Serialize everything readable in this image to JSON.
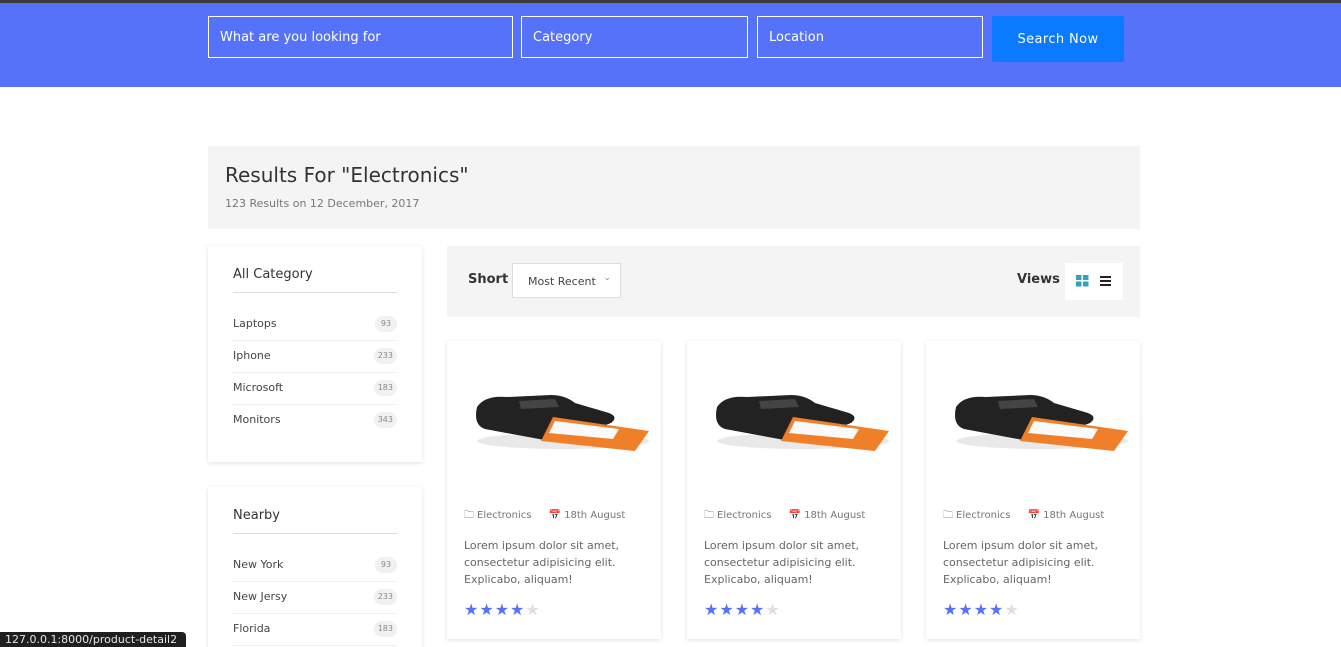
{
  "search": {
    "keyword_placeholder": "What are you looking for",
    "category_placeholder": "Category",
    "location_placeholder": "Location",
    "button_label": "Search Now"
  },
  "results": {
    "title": "Results For \"Electronics\"",
    "subtitle": "123 Results on 12 December, 2017"
  },
  "sidebar": {
    "categories": {
      "heading": "All Category",
      "items": [
        {
          "label": "Laptops",
          "count": "93"
        },
        {
          "label": "Iphone",
          "count": "233"
        },
        {
          "label": "Microsoft",
          "count": "183"
        },
        {
          "label": "Monitors",
          "count": "343"
        }
      ]
    },
    "nearby": {
      "heading": "Nearby",
      "items": [
        {
          "label": "New York",
          "count": "93"
        },
        {
          "label": "New Jersy",
          "count": "233"
        },
        {
          "label": "Florida",
          "count": "183"
        }
      ]
    }
  },
  "toolbar": {
    "sort_label": "Short",
    "sort_value": "Most Recent",
    "views_label": "Views",
    "grid_icon": "grid-view-icon",
    "list_icon": "list-view-icon"
  },
  "products": [
    {
      "category": "Electronics",
      "date": "18th August",
      "description": "Lorem ipsum dolor sit amet, consectetur adipisicing elit. Explicabo, aliquam!",
      "rating": 4,
      "rating_max": 5
    },
    {
      "category": "Electronics",
      "date": "18th August",
      "description": "Lorem ipsum dolor sit amet, consectetur adipisicing elit. Explicabo, aliquam!",
      "rating": 4,
      "rating_max": 5
    },
    {
      "category": "Electronics",
      "date": "18th August",
      "description": "Lorem ipsum dolor sit amet, consectetur adipisicing elit. Explicabo, aliquam!",
      "rating": 4,
      "rating_max": 5
    }
  ],
  "status_bar": {
    "url": "127.0.0.1:8000/product-detail2"
  },
  "colors": {
    "accent": "#5672f9",
    "button": "#0a7afe",
    "panel_bg": "#f4f4f4"
  }
}
